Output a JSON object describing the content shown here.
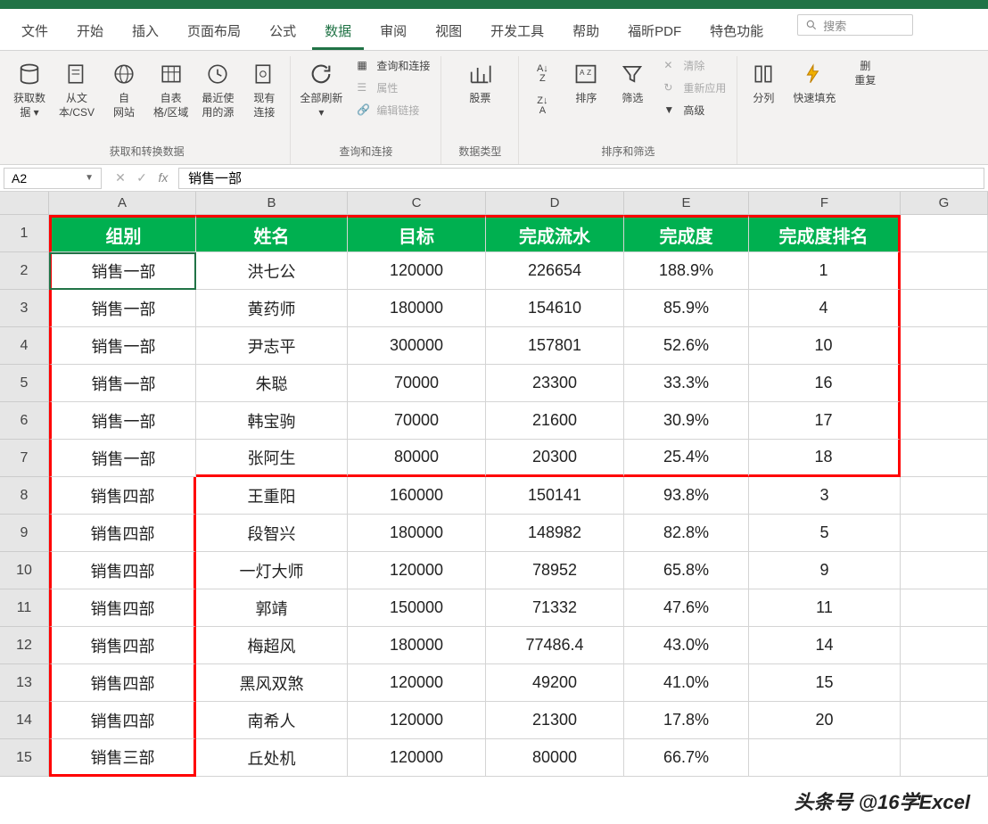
{
  "tabs": {
    "file": "文件",
    "home": "开始",
    "insert": "插入",
    "layout": "页面布局",
    "formula": "公式",
    "data": "数据",
    "review": "审阅",
    "view": "视图",
    "dev": "开发工具",
    "help": "帮助",
    "pdf": "福昕PDF",
    "feature": "特色功能"
  },
  "search_placeholder": "搜索",
  "ribbon": {
    "g1": {
      "get_data": "获取数\n据 ▾",
      "from_csv": "从文\n本/CSV",
      "from_web": "自\n网站",
      "from_table": "自表\n格/区域",
      "recent": "最近使\n用的源",
      "existing": "现有\n连接",
      "label": "获取和转换数据"
    },
    "g2": {
      "refresh": "全部刷新\n▾",
      "qc": "查询和连接",
      "prop": "属性",
      "editlink": "编辑链接",
      "label": "查询和连接"
    },
    "g3": {
      "stocks": "股票",
      "label": "数据类型"
    },
    "g4": {
      "sort": "排序",
      "filter": "筛选",
      "clear": "清除",
      "reapply": "重新应用",
      "adv": "高级",
      "label": "排序和筛选"
    },
    "g5": {
      "ttc": "分列",
      "flash": "快速填充",
      "dup": "删\n重复"
    }
  },
  "namebox": "A2",
  "formula": "销售一部",
  "cols": [
    "A",
    "B",
    "C",
    "D",
    "E",
    "F",
    "G"
  ],
  "headers": [
    "组别",
    "姓名",
    "目标",
    "完成流水",
    "完成度",
    "完成度排名"
  ],
  "rows": [
    {
      "n": 2,
      "a": "销售一部",
      "b": "洪七公",
      "c": "120000",
      "d": "226654",
      "e": "188.9%",
      "f": "1"
    },
    {
      "n": 3,
      "a": "销售一部",
      "b": "黄药师",
      "c": "180000",
      "d": "154610",
      "e": "85.9%",
      "f": "4"
    },
    {
      "n": 4,
      "a": "销售一部",
      "b": "尹志平",
      "c": "300000",
      "d": "157801",
      "e": "52.6%",
      "f": "10"
    },
    {
      "n": 5,
      "a": "销售一部",
      "b": "朱聪",
      "c": "70000",
      "d": "23300",
      "e": "33.3%",
      "f": "16"
    },
    {
      "n": 6,
      "a": "销售一部",
      "b": "韩宝驹",
      "c": "70000",
      "d": "21600",
      "e": "30.9%",
      "f": "17"
    },
    {
      "n": 7,
      "a": "销售一部",
      "b": "张阿生",
      "c": "80000",
      "d": "20300",
      "e": "25.4%",
      "f": "18"
    },
    {
      "n": 8,
      "a": "销售四部",
      "b": "王重阳",
      "c": "160000",
      "d": "150141",
      "e": "93.8%",
      "f": "3"
    },
    {
      "n": 9,
      "a": "销售四部",
      "b": "段智兴",
      "c": "180000",
      "d": "148982",
      "e": "82.8%",
      "f": "5"
    },
    {
      "n": 10,
      "a": "销售四部",
      "b": "一灯大师",
      "c": "120000",
      "d": "78952",
      "e": "65.8%",
      "f": "9"
    },
    {
      "n": 11,
      "a": "销售四部",
      "b": "郭靖",
      "c": "150000",
      "d": "71332",
      "e": "47.6%",
      "f": "11"
    },
    {
      "n": 12,
      "a": "销售四部",
      "b": "梅超风",
      "c": "180000",
      "d": "77486.4",
      "e": "43.0%",
      "f": "14"
    },
    {
      "n": 13,
      "a": "销售四部",
      "b": "黑风双煞",
      "c": "120000",
      "d": "49200",
      "e": "41.0%",
      "f": "15"
    },
    {
      "n": 14,
      "a": "销售四部",
      "b": "南希人",
      "c": "120000",
      "d": "21300",
      "e": "17.8%",
      "f": "20"
    },
    {
      "n": 15,
      "a": "销售三部",
      "b": "丘处机",
      "c": "120000",
      "d": "80000",
      "e": "66.7%",
      "f": ""
    }
  ],
  "watermark": "头条号 @16学Excel"
}
